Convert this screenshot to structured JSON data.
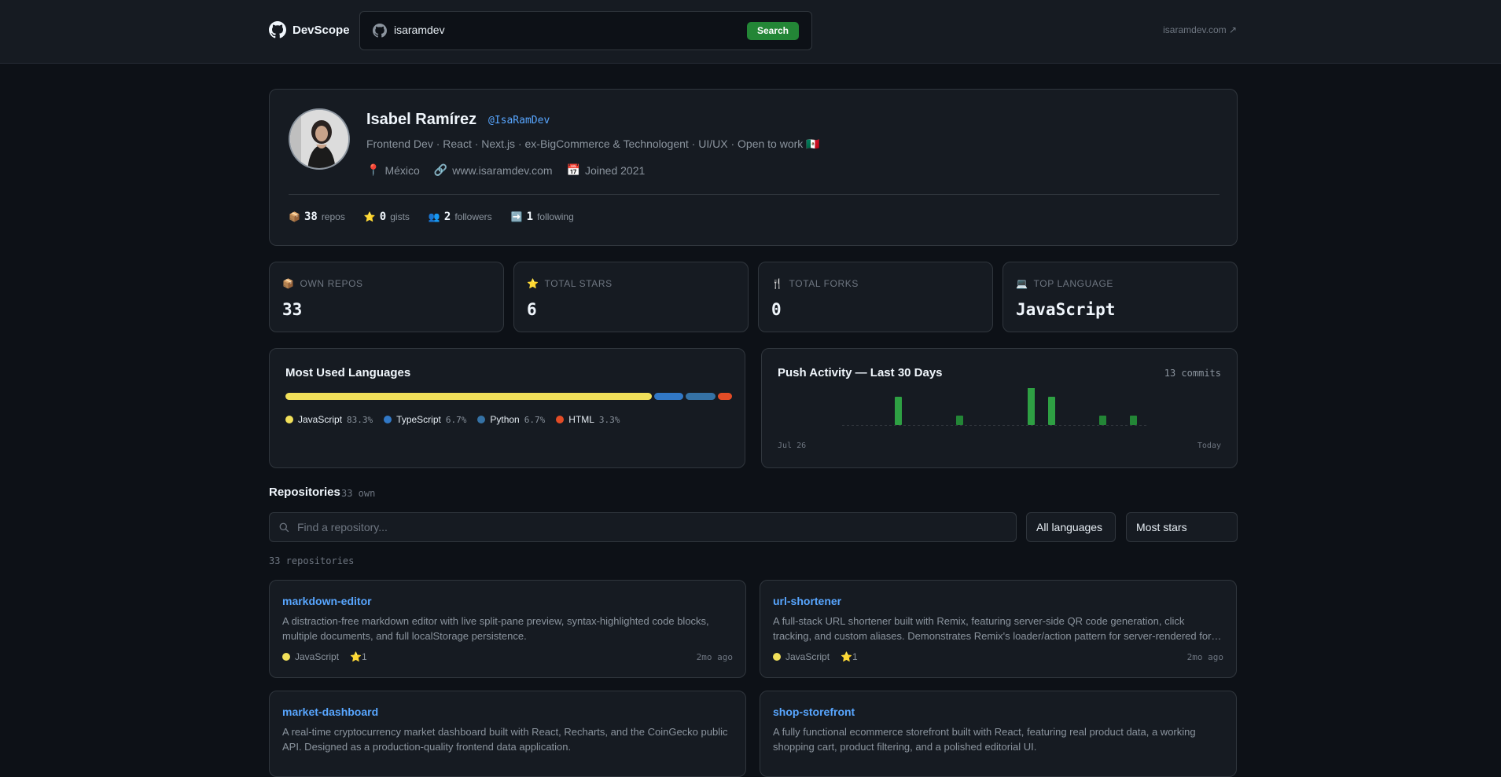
{
  "header": {
    "brand": "DevScope",
    "search_value": "isaramdev",
    "search_button": "Search",
    "external_link": "isaramdev.com ↗"
  },
  "profile": {
    "name": "Isabel Ramírez",
    "handle": "@IsaRamDev",
    "bio": "Frontend Dev · React · Next.js · ex-BigCommerce & Technologent · UI/UX · Open to work 🇲🇽",
    "location": "México",
    "website": "www.isaramdev.com",
    "joined": "Joined 2021",
    "counts": [
      {
        "icon": "📦",
        "value": "38",
        "label": "repos"
      },
      {
        "icon": "⭐",
        "value": "0",
        "label": "gists"
      },
      {
        "icon": "👥",
        "value": "2",
        "label": "followers"
      },
      {
        "icon": "➡️",
        "value": "1",
        "label": "following"
      }
    ]
  },
  "stats": [
    {
      "icon": "📦",
      "label": "OWN REPOS",
      "value": "33"
    },
    {
      "icon": "⭐",
      "label": "TOTAL STARS",
      "value": "6"
    },
    {
      "icon": "🍴",
      "label": "TOTAL FORKS",
      "value": "0"
    },
    {
      "icon": "💻",
      "label": "TOP LANGUAGE",
      "value": "JavaScript"
    }
  ],
  "languages": {
    "title": "Most Used Languages",
    "items": [
      {
        "name": "JavaScript",
        "pct": "83.3%",
        "value": 83.3,
        "color": "#f1e05a"
      },
      {
        "name": "TypeScript",
        "pct": "6.7%",
        "value": 6.7,
        "color": "#3178c6"
      },
      {
        "name": "Python",
        "pct": "6.7%",
        "value": 6.7,
        "color": "#3572A5"
      },
      {
        "name": "HTML",
        "pct": "3.3%",
        "value": 3.3,
        "color": "#e34c26"
      }
    ]
  },
  "activity": {
    "title": "Push Activity — Last 30 Days",
    "commits": "13 commits",
    "start_label": "Jul 26",
    "end_label": "Today",
    "daily": [
      0,
      0,
      0,
      0,
      0,
      3,
      0,
      0,
      0,
      0,
      0,
      1,
      0,
      0,
      0,
      0,
      0,
      0,
      4,
      0,
      3,
      0,
      0,
      0,
      0,
      1,
      0,
      0,
      1,
      0
    ],
    "colors": {
      "bar": "#238636",
      "bar_light": "#2ea043",
      "baseline": "#30363d"
    }
  },
  "repos_section": {
    "title": "Repositories",
    "sub": "33 own",
    "filter_placeholder": "Find a repository...",
    "language_select": "All languages",
    "sort_select": "Most stars",
    "count_label": "33 repositories"
  },
  "repos": [
    {
      "name": "markdown-editor",
      "desc": "A distraction-free markdown editor with live split-pane preview, syntax-highlighted code blocks, multiple documents, and full localStorage persistence.",
      "lang": "JavaScript",
      "stars": "1",
      "updated": "2mo ago"
    },
    {
      "name": "url-shortener",
      "desc": "A full-stack URL shortener built with Remix, featuring server-side QR code generation, click tracking, and custom aliases. Demonstrates Remix's loader/action pattern for server-rendered forms with…",
      "lang": "JavaScript",
      "stars": "1",
      "updated": "2mo ago"
    },
    {
      "name": "market-dashboard",
      "desc": "A real-time cryptocurrency market dashboard built with React, Recharts, and the CoinGecko public API. Designed as a production-quality frontend data application.",
      "lang": "",
      "stars": "",
      "updated": ""
    },
    {
      "name": "shop-storefront",
      "desc": "A fully functional ecommerce storefront built with React, featuring real product data, a working shopping cart, product filtering, and a polished editorial UI.",
      "lang": "",
      "stars": "",
      "updated": ""
    }
  ]
}
